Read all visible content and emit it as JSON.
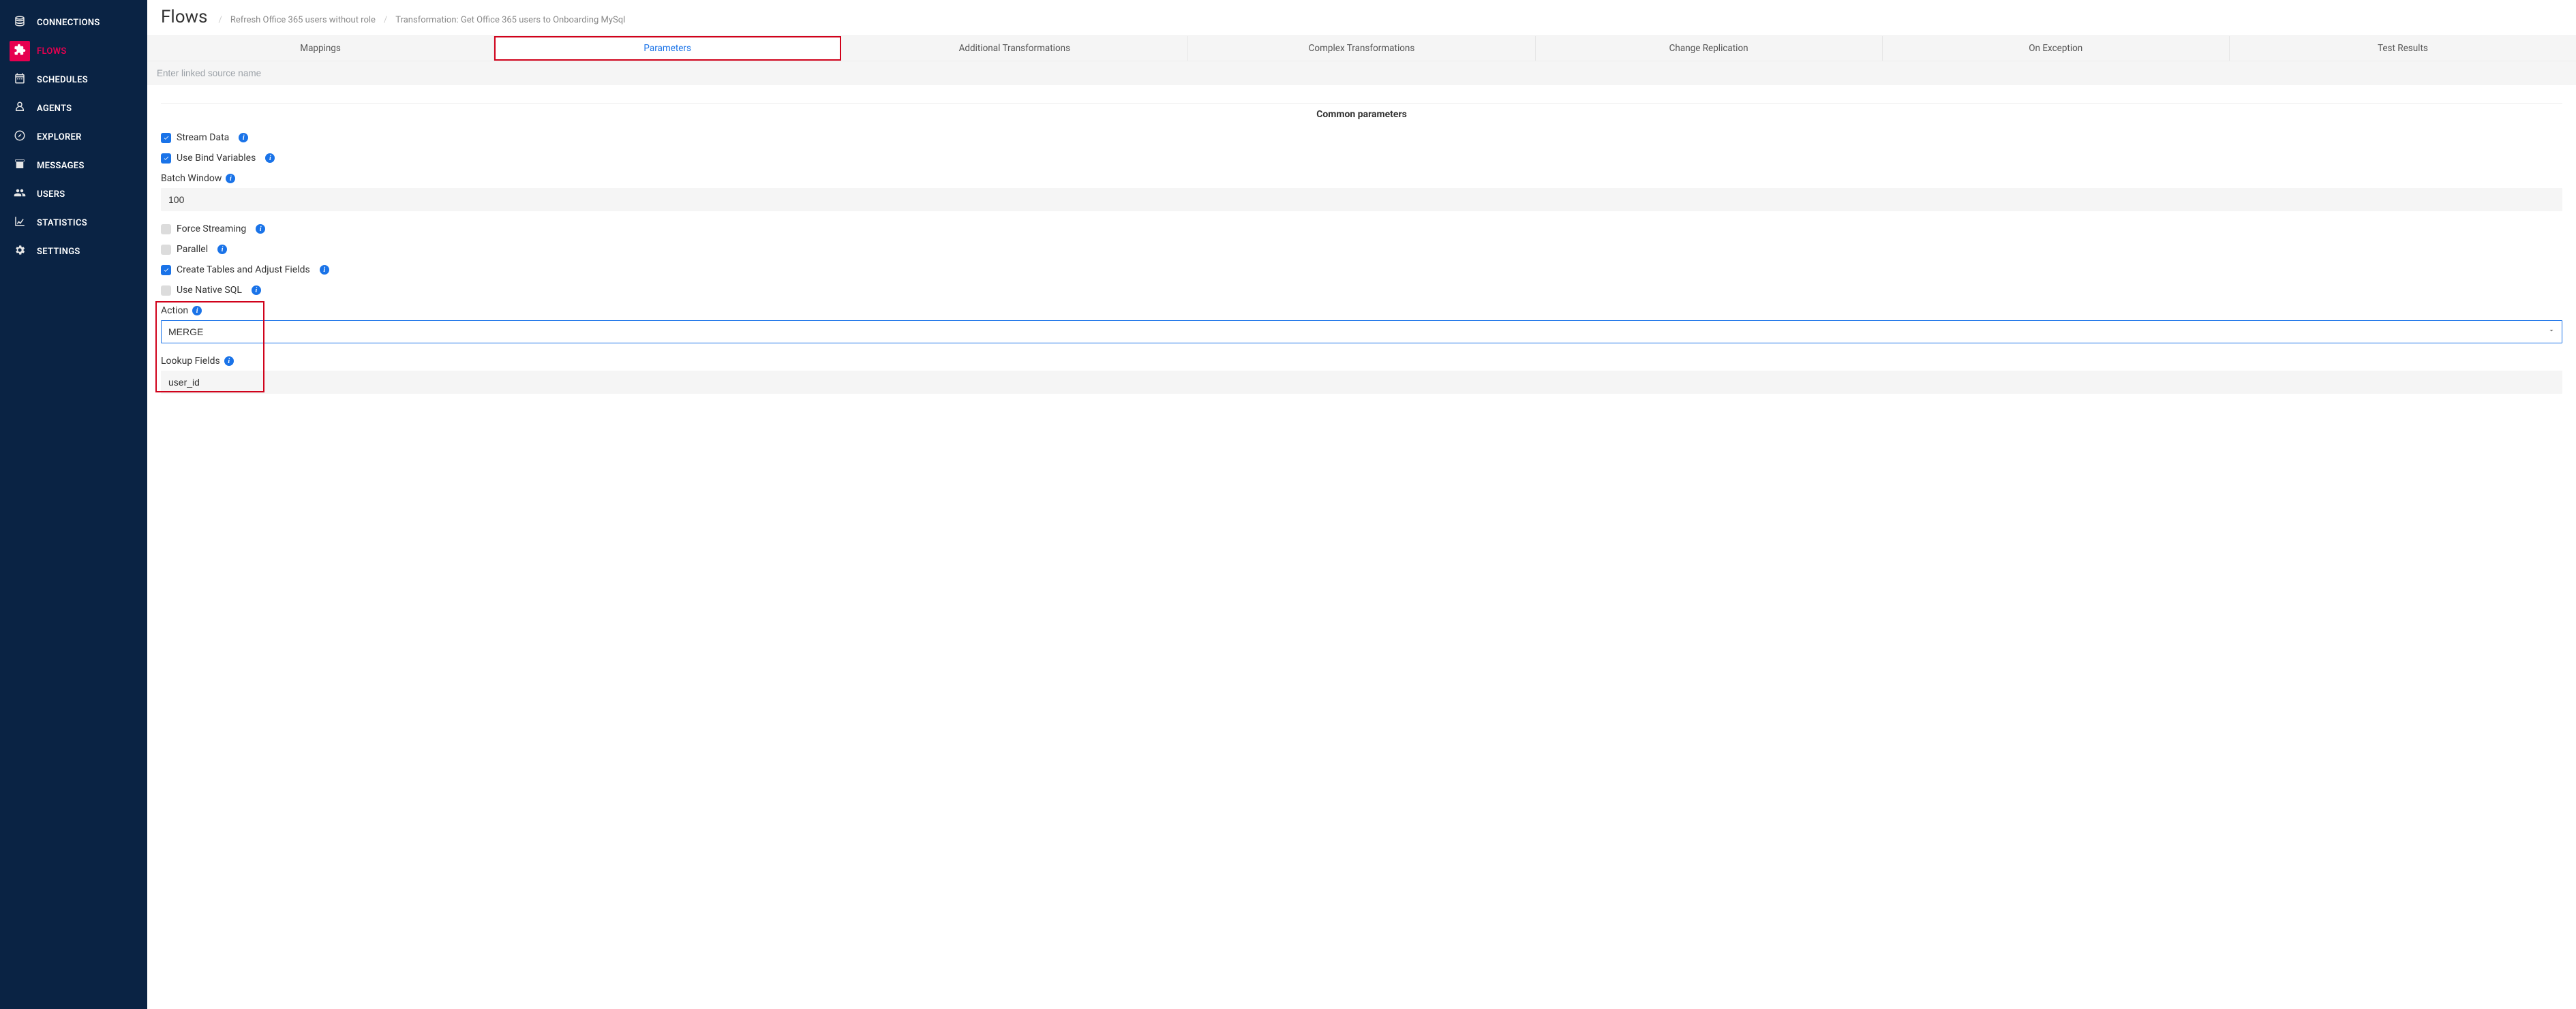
{
  "sidebar": {
    "items": [
      {
        "label": "CONNECTIONS",
        "icon": "connections"
      },
      {
        "label": "FLOWS",
        "icon": "flows",
        "active": true
      },
      {
        "label": "SCHEDULES",
        "icon": "schedules"
      },
      {
        "label": "AGENTS",
        "icon": "agents"
      },
      {
        "label": "EXPLORER",
        "icon": "explorer"
      },
      {
        "label": "MESSAGES",
        "icon": "messages"
      },
      {
        "label": "USERS",
        "icon": "users"
      },
      {
        "label": "STATISTICS",
        "icon": "statistics"
      },
      {
        "label": "SETTINGS",
        "icon": "settings"
      }
    ]
  },
  "header": {
    "title": "Flows",
    "breadcrumbs": [
      "Refresh Office 365 users without role",
      "Transformation: Get Office 365 users to Onboarding MySql"
    ]
  },
  "tabs": [
    {
      "label": "Mappings"
    },
    {
      "label": "Parameters",
      "active": true,
      "highlighted": true
    },
    {
      "label": "Additional Transformations"
    },
    {
      "label": "Complex Transformations"
    },
    {
      "label": "Change Replication"
    },
    {
      "label": "On Exception"
    },
    {
      "label": "Test Results"
    }
  ],
  "linked_source_placeholder": "Enter linked source name",
  "section_title": "Common parameters",
  "params": {
    "stream_data": {
      "label": "Stream Data",
      "checked": true
    },
    "use_bind_vars": {
      "label": "Use Bind Variables",
      "checked": true
    },
    "batch_window": {
      "label": "Batch Window",
      "value": "100"
    },
    "force_streaming": {
      "label": "Force Streaming",
      "checked": false
    },
    "parallel": {
      "label": "Parallel",
      "checked": false
    },
    "create_tables": {
      "label": "Create Tables and Adjust Fields",
      "checked": true
    },
    "use_native_sql": {
      "label": "Use Native SQL",
      "checked": false
    },
    "action": {
      "label": "Action",
      "value": "MERGE"
    },
    "lookup_fields": {
      "label": "Lookup Fields",
      "value": "user_id"
    }
  }
}
